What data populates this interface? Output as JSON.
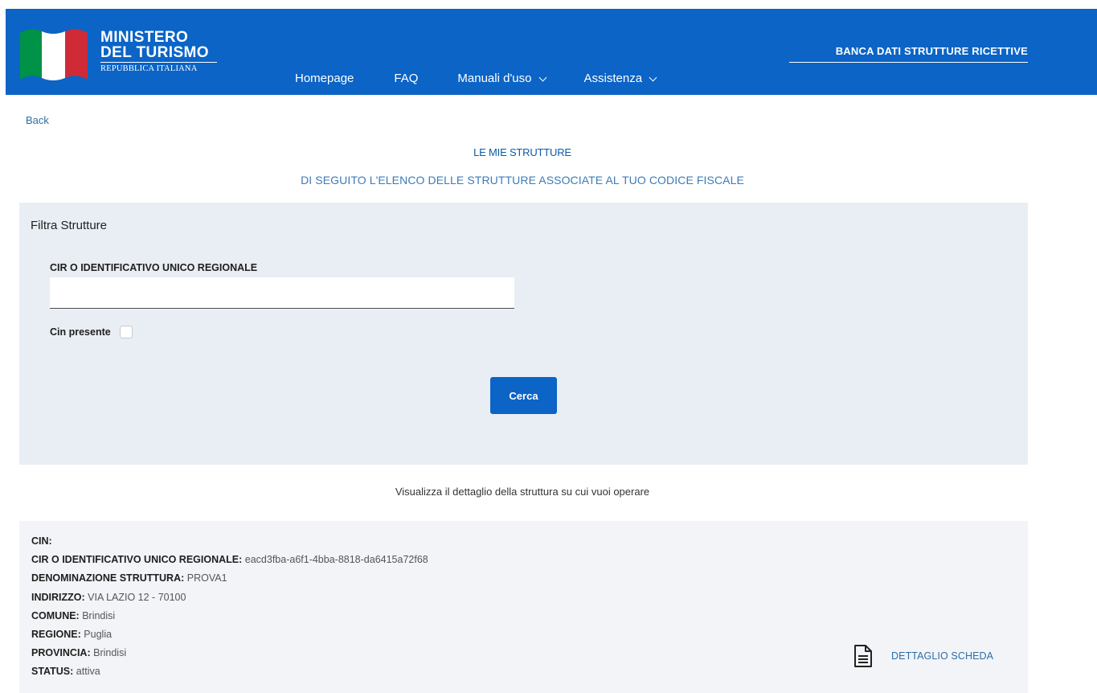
{
  "header": {
    "logo_line1": "MINISTERO",
    "logo_line2": "DEL TURISMO",
    "logo_line3": "REPUBBLICA ITALIANA",
    "app_title": "BANCA DATI STRUTTURE RICETTIVE",
    "nav": [
      {
        "label": "Homepage"
      },
      {
        "label": "FAQ"
      },
      {
        "label": "Manuali d'uso"
      },
      {
        "label": "Assistenza"
      }
    ]
  },
  "page": {
    "back": "Back",
    "title": "LE MIE STRUTTURE",
    "subtitle": "DI SEGUITO L'ELENCO DELLE STRUTTURE ASSOCIATE AL TUO CODICE FISCALE",
    "hint": "Visualizza il dettaglio della struttura su cui vuoi operare"
  },
  "filter": {
    "title": "Filtra Strutture",
    "cir_label": "CIR O IDENTIFICATIVO UNICO REGIONALE",
    "cir_value": "",
    "cin_label": "Cin presente",
    "cin_checked": false,
    "search_button": "Cerca"
  },
  "structure": {
    "cin_label": "CIN:",
    "cin_value": "",
    "cir_label": "CIR O IDENTIFICATIVO UNICO REGIONALE:",
    "cir_value": "eacd3fba-a6f1-4bba-8818-da6415a72f68",
    "name_label": "DENOMINAZIONE STRUTTURA:",
    "name_value": "PROVA1",
    "address_label": "INDIRIZZO:",
    "address_value": "VIA LAZIO 12 - 70100",
    "comune_label": "COMUNE:",
    "comune_value": "Brindisi",
    "regione_label": "REGIONE:",
    "regione_value": "Puglia",
    "provincia_label": "PROVINCIA:",
    "provincia_value": "Brindisi",
    "status_label": "STATUS:",
    "status_value": "attiva",
    "detail_link": "DETTAGLIO SCHEDA"
  },
  "colors": {
    "brand_blue": "#0b64c6",
    "filter_bg": "#e9eef5",
    "detail_bg": "#f2f4f7",
    "flag_green": "#009246",
    "flag_white": "#ffffff",
    "flag_red": "#ce2b37"
  },
  "icons": {
    "logo": "italian-flag-logo",
    "dropdown": "chevron-down-icon",
    "detail": "document-icon"
  }
}
